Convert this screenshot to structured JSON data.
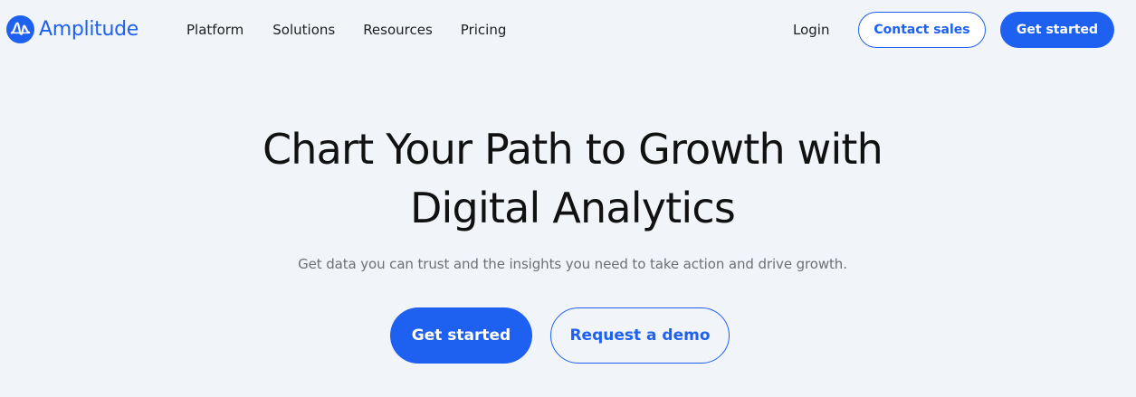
{
  "nav": {
    "logo_text": "Amplitude",
    "links": [
      {
        "label": "Platform"
      },
      {
        "label": "Solutions"
      },
      {
        "label": "Resources"
      },
      {
        "label": "Pricing"
      }
    ],
    "login_label": "Login",
    "contact_sales_label": "Contact sales",
    "get_started_label": "Get started"
  },
  "hero": {
    "title_line1": "Chart Your Path to Growth with",
    "title_line2": "Digital Analytics",
    "subtitle": "Get data you can trust and the insights you need to take action and drive growth.",
    "primary_cta": "Get started",
    "secondary_cta": "Request a demo"
  },
  "colors": {
    "brand_blue": "#1e61f0",
    "background": "#f1f4f9",
    "text_dark": "#1d1e21",
    "text_muted": "#6e7079"
  },
  "icons": {
    "logo": "amplitude-logo-icon"
  }
}
